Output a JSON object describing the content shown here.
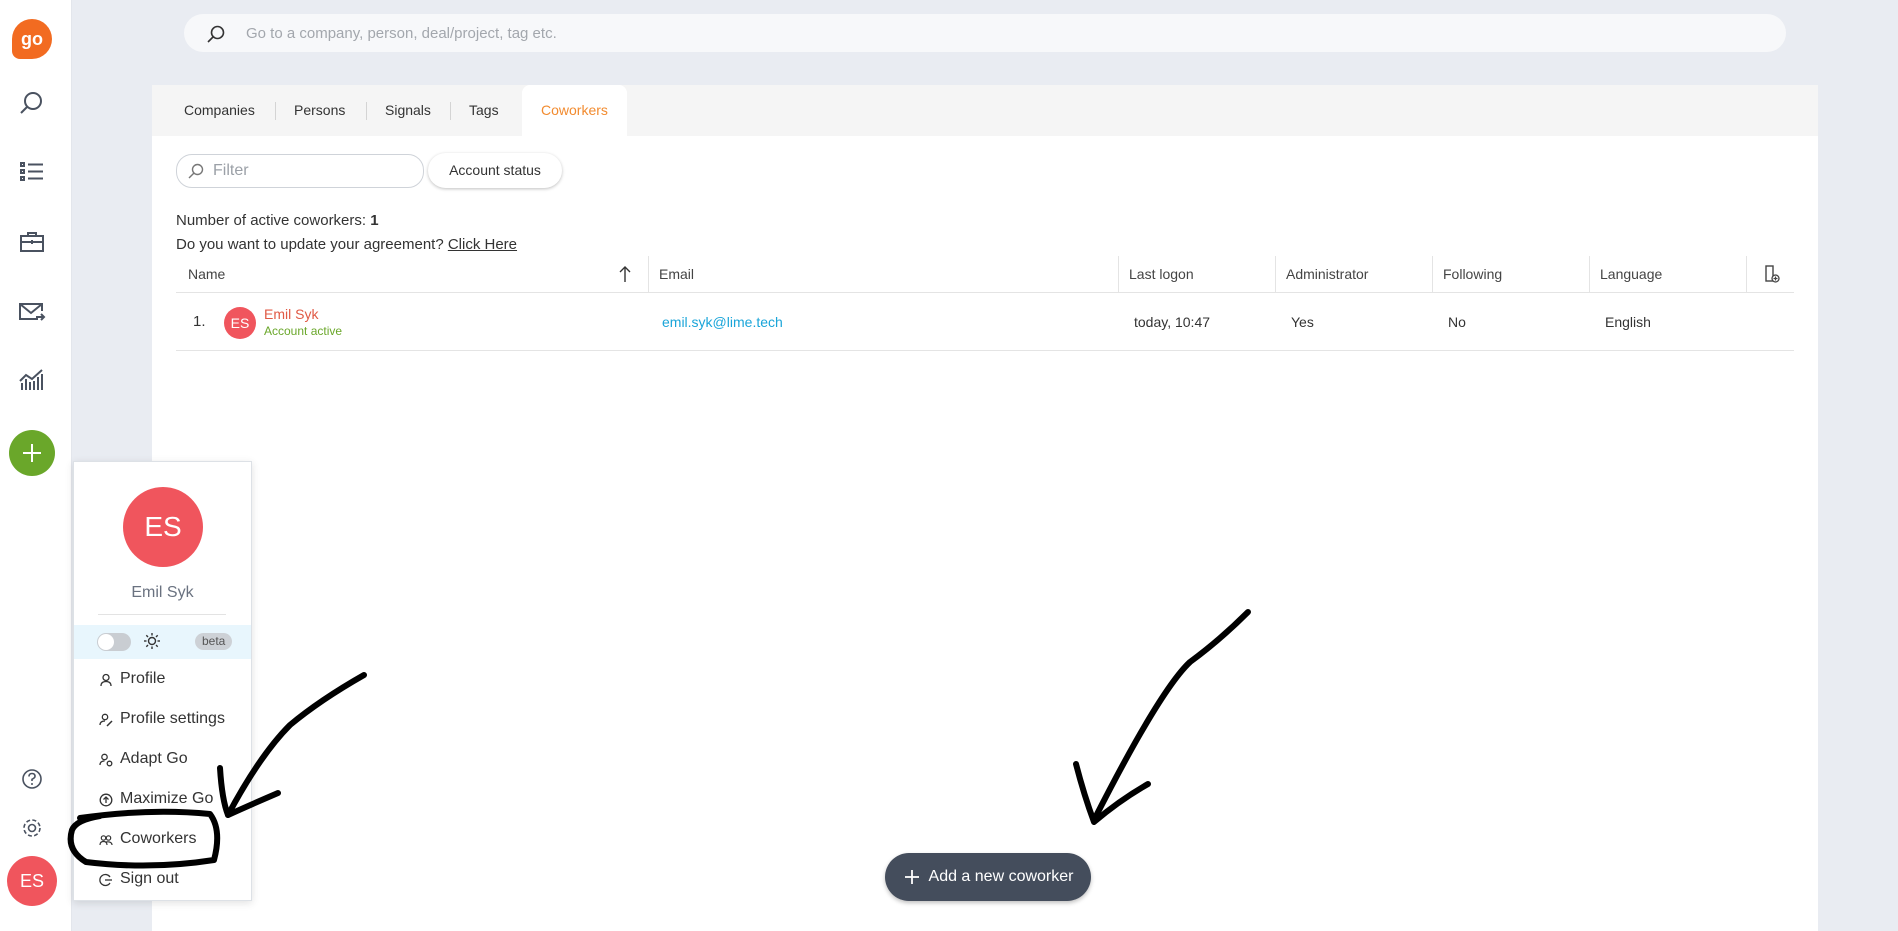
{
  "rail": {
    "logo_text": "go",
    "avatar_initials": "ES",
    "accent": "#f26b21",
    "plus_color": "#6aa72a"
  },
  "search": {
    "placeholder": "Go to a company, person, deal/project, tag etc."
  },
  "tabs": [
    {
      "label": "Companies"
    },
    {
      "label": "Persons"
    },
    {
      "label": "Signals"
    },
    {
      "label": "Tags"
    },
    {
      "label": "Coworkers",
      "active": true
    }
  ],
  "toolbar": {
    "filter_placeholder": "Filter",
    "account_status_label": "Account status"
  },
  "info": {
    "active_label": "Number of active coworkers:",
    "active_count": "1",
    "agreement_text": "Do you want to update your agreement?",
    "agreement_link": "Click Here"
  },
  "table": {
    "columns": [
      "Name",
      "Email",
      "Last logon",
      "Administrator",
      "Following",
      "Language"
    ],
    "rows": [
      {
        "index": "1.",
        "initials": "ES",
        "name": "Emil Syk",
        "status": "Account active",
        "email": "emil.syk@lime.tech",
        "last_logon": "today, 10:47",
        "administrator": "Yes",
        "following": "No",
        "language": "English"
      }
    ]
  },
  "menu": {
    "initials": "ES",
    "name": "Emil Syk",
    "beta_label": "beta",
    "items": [
      {
        "label": "Profile",
        "icon": "person-icon"
      },
      {
        "label": "Profile settings",
        "icon": "person-edit-icon"
      },
      {
        "label": "Adapt Go",
        "icon": "person-gear-icon"
      },
      {
        "label": "Maximize Go",
        "icon": "arrow-up-circle-icon"
      },
      {
        "label": "Coworkers",
        "icon": "people-icon"
      },
      {
        "label": "Sign out",
        "icon": "sign-out-icon"
      }
    ]
  },
  "add_button": {
    "label": "Add a new coworker"
  }
}
